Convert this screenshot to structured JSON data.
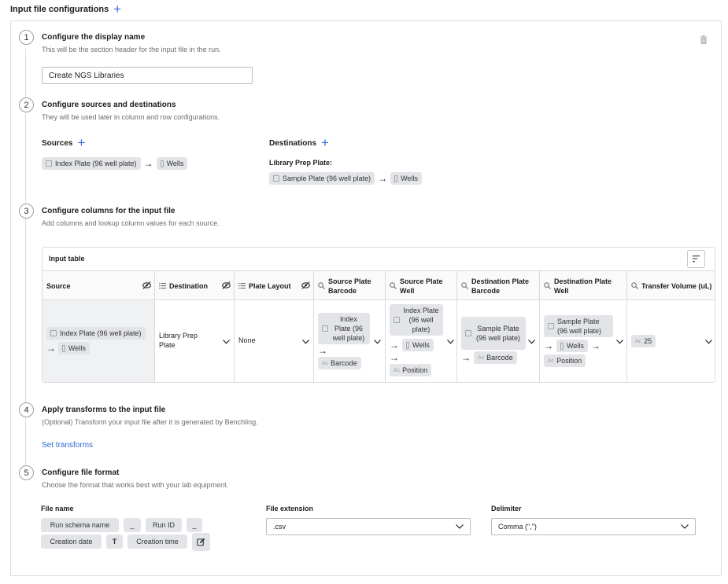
{
  "header": {
    "title": "Input file configurations"
  },
  "steps": [
    {
      "num": "1",
      "title": "Configure the display name",
      "desc": "This will be the section header for the input file in the run."
    },
    {
      "num": "2",
      "title": "Configure sources and destinations",
      "desc": "They will be used later in column and row configurations."
    },
    {
      "num": "3",
      "title": "Configure columns for the input file",
      "desc": "Add columns and lookup column values for each source."
    },
    {
      "num": "4",
      "title": "Apply transforms to the input file",
      "desc": "(Optional) Transform your input file after it is generated by Benchling."
    },
    {
      "num": "5",
      "title": "Configure file format",
      "desc": "Choose the format that works best with your lab equipment."
    }
  ],
  "display_name": {
    "value": "Create NGS Libraries"
  },
  "sources": {
    "label": "Sources",
    "plate": "Index Plate (96 well plate)",
    "wells": "Wells"
  },
  "destinations": {
    "label": "Destinations",
    "group": "Library Prep Plate:",
    "plate": "Sample Plate (96 well plate)",
    "wells": "Wells"
  },
  "input_table": {
    "title": "Input table",
    "columns": [
      "Source",
      "Destination",
      "Plate Layout",
      "Source Plate Barcode",
      "Source Plate Well",
      "Destination Plate Barcode",
      "Destination Plate Well",
      "Transfer Volume (uL)"
    ],
    "row": {
      "source_plate": "Index Plate (96 well plate)",
      "source_wells": "Wells",
      "destination": "Library Prep Plate",
      "plate_layout": "None",
      "src_barcode_plate": "Index Plate (96 well plate)",
      "src_barcode_field": "Barcode",
      "src_well_plate": "Index Plate (96 well plate)",
      "src_well_wells": "Wells",
      "src_well_field": "Position",
      "dst_barcode_plate": "Sample Plate (96 well plate)",
      "dst_barcode_field": "Barcode",
      "dst_well_plate": "Sample Plate (96 well plate)",
      "dst_well_wells": "Wells",
      "dst_well_field": "Position",
      "transfer_volume": "25"
    }
  },
  "transforms": {
    "link": "Set transforms"
  },
  "file_format": {
    "file_name_label": "File name",
    "tokens": [
      "Run schema name",
      "_",
      "Run ID",
      "_",
      "Creation date",
      "T",
      "Creation time"
    ],
    "extension_label": "File extension",
    "extension_value": ".csv",
    "delimiter_label": "Delimiter",
    "delimiter_value": "Comma (\",\")"
  },
  "icon_text": {
    "ac": "Ac"
  }
}
